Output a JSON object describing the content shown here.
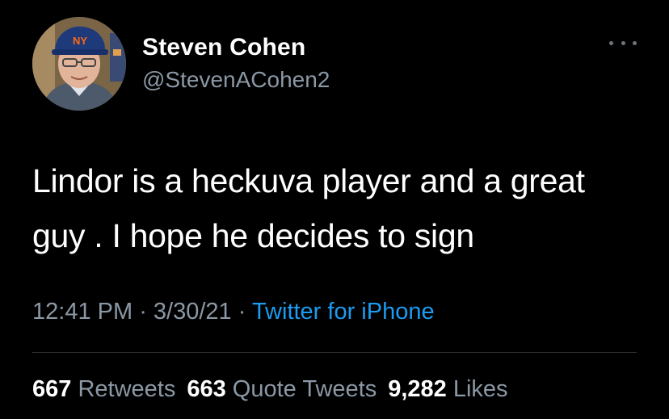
{
  "colors": {
    "background": "#000000",
    "primary_text": "#ffffff",
    "secondary_text": "#8b98a5",
    "link": "#1d9bf0",
    "divider": "#2f3336"
  },
  "author": {
    "display_name": "Steven Cohen",
    "handle": "@StevenACohen2",
    "avatar_icon": "user-avatar"
  },
  "more_icon": "more-horizontal-icon",
  "tweet": {
    "text": "Lindor is a heckuva player and a great guy . I hope he decides to sign",
    "time": "12:41 PM",
    "sep1": " · ",
    "date": "3/30/21",
    "sep2": " · ",
    "source": "Twitter for iPhone"
  },
  "stats": {
    "retweets": {
      "count": "667",
      "label": "Retweets"
    },
    "quote_tweets": {
      "count": "663",
      "label": "Quote Tweets"
    },
    "likes": {
      "count": "9,282",
      "label": "Likes"
    }
  }
}
